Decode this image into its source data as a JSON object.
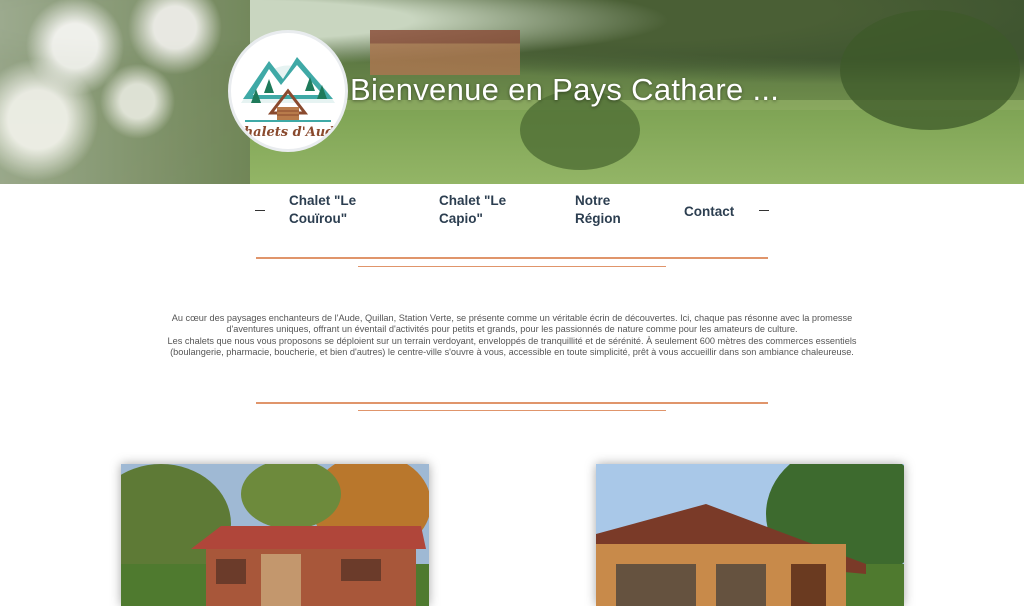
{
  "hero": {
    "title": "Bienvenue en Pays Cathare ...",
    "logo_text": "Chalets d'Aude"
  },
  "nav": {
    "items": [
      {
        "label_line1": "Chalet \"Le",
        "label_line2": "Couïrou\""
      },
      {
        "label_line1": "Chalet \"Le",
        "label_line2": "Capio\""
      },
      {
        "label_line1": "Notre",
        "label_line2": "Région"
      },
      {
        "label_line1": "Contact",
        "label_line2": ""
      }
    ]
  },
  "intro": {
    "line1": "Au cœur des paysages enchanteurs de l'Aude, Quillan, Station Verte, se présente comme un véritable écrin de découvertes. Ici, chaque pas résonne avec la promesse",
    "line2": "d'aventures uniques, offrant un éventail d'activités pour petits et grands, pour les passionnés de nature comme pour les amateurs de culture.",
    "line3": "Les chalets que nous vous proposons se déploient sur un terrain verdoyant, enveloppés de tranquillité et de sérénité. À seulement 600 mètres des commerces essentiels",
    "line4": "(boulangerie, pharmacie, boucherie, et bien d'autres) le centre-ville s'ouvre à vous, accessible en toute simplicité, prêt à vous accueillir dans son ambiance chaleureuse."
  },
  "colors": {
    "accent": "#e0956b",
    "nav_text": "#2c3e50",
    "logo_teal": "#3fa9a6",
    "logo_brown": "#8a4a2e"
  }
}
